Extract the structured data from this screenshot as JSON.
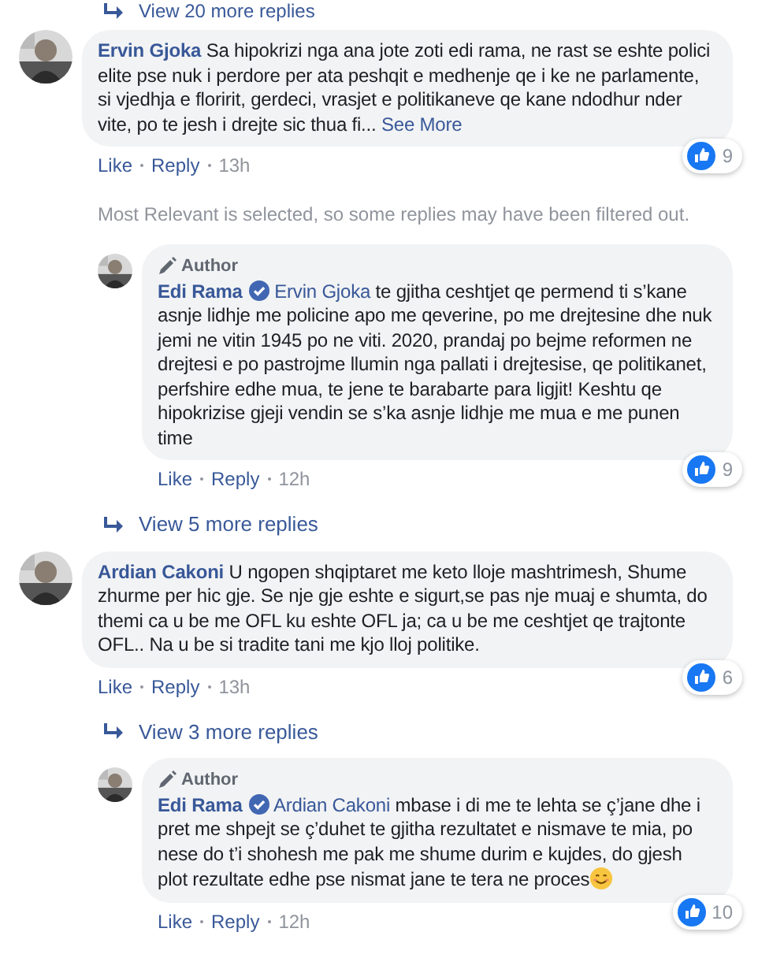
{
  "top_link": "View 20 more replies",
  "items": [
    {
      "kind": "comment",
      "author": "Ervin Gjoka",
      "text": "Sa hipokrizi nga ana jote zoti edi rama, ne rast se eshte polici elite pse nuk i perdore per ata peshqit e medhenje qe i ke ne parlamente, si vjedhja e floririt, gerdeci, vrasjet e politikaneve qe kane ndodhur nder vite, po te jesh i drejte sic thua fi...",
      "see_more": "See More",
      "reactions": "9",
      "actions": [
        "Like",
        "Reply"
      ],
      "time": "13h"
    },
    {
      "kind": "notice",
      "text": "Most Relevant is selected, so some replies may have been filtered out."
    },
    {
      "kind": "reply",
      "badge": "Author",
      "author": "Edi Rama",
      "verified": true,
      "mention": "Ervin Gjoka",
      "text": "te gjitha ceshtjet qe permend ti s’kane asnje lidhje me policine apo me qeverine, po me drejtesine dhe nuk jemi ne vitin 1945 po ne viti. 2020, prandaj po bejme reformen ne drejtesi e po pastrojme llumin nga pallati i drejtesise, qe politikanet, perfshire edhe mua, te jene te barabarte para ligjit! Keshtu qe hipokrizise gjeji vendin se s’ka asnje lidhje me mua e me punen time",
      "reactions": "9",
      "actions": [
        "Like",
        "Reply"
      ],
      "time": "12h"
    },
    {
      "kind": "more",
      "text": "View 5 more replies"
    },
    {
      "kind": "comment",
      "author": "Ardian Cakoni",
      "text": "U ngopen shqiptaret me keto lloje mashtrimesh, Shume zhurme per hic gje. Se nje gje eshte e sigurt,se pas nje muaj e shumta, do themi ca u be me OFL ku eshte OFL ja; ca u be me ceshtjet qe trajtonte OFL.. Na u be si tradite tani me kjo lloj politike.",
      "reactions": "6",
      "actions": [
        "Like",
        "Reply"
      ],
      "time": "13h"
    },
    {
      "kind": "more",
      "text": "View 3 more replies"
    },
    {
      "kind": "reply",
      "badge": "Author",
      "author": "Edi Rama",
      "verified": true,
      "mention": "Ardian Cakoni",
      "text": "mbase i di me te lehta se ç’jane dhe i pret me shpejt se ç’duhet te gjitha rezultatet e nismave te mia, po nese do t’i shohesh me pak me shume durim e kujdes, do gjesh plot rezultate edhe pse nismat jane te tera ne proces",
      "emoji": true,
      "reactions": "10",
      "actions": [
        "Like",
        "Reply"
      ],
      "time": "12h"
    }
  ]
}
